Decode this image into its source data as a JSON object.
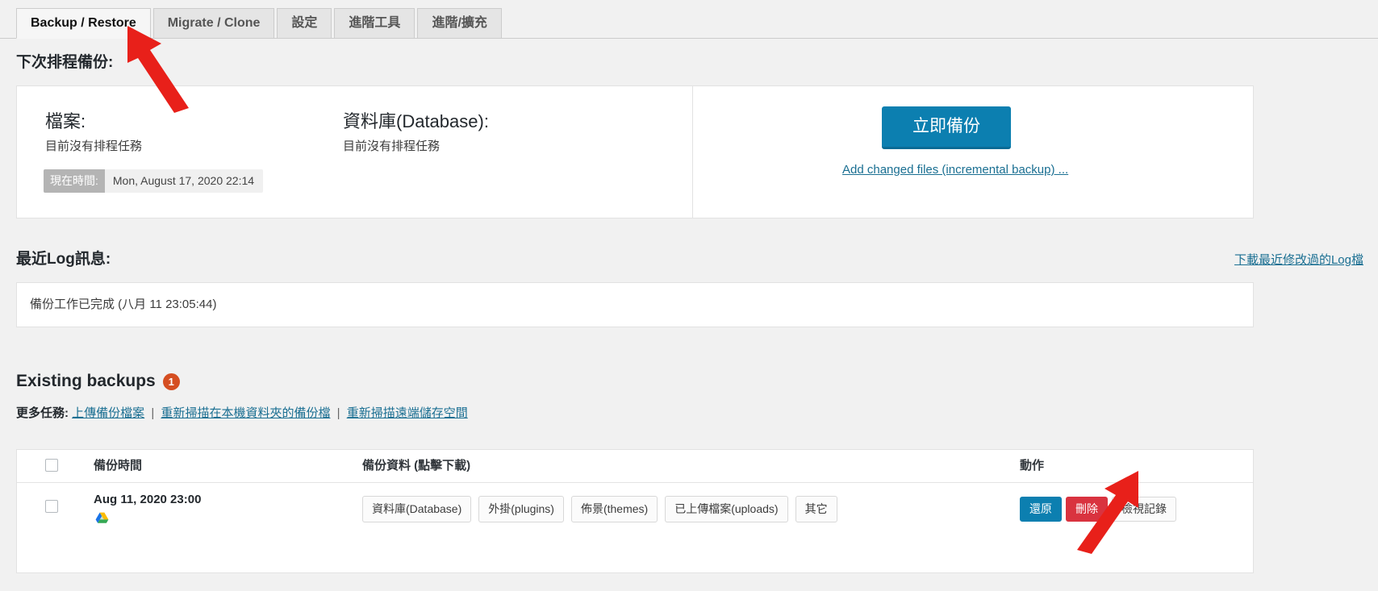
{
  "tabs": [
    {
      "label": "Backup / Restore",
      "active": true
    },
    {
      "label": "Migrate / Clone",
      "active": false
    },
    {
      "label": "設定",
      "active": false
    },
    {
      "label": "進階工具",
      "active": false
    },
    {
      "label": "進階/擴充",
      "active": false
    }
  ],
  "schedule": {
    "heading": "下次排程備份:",
    "files": {
      "title": "檔案:",
      "status": "目前沒有排程任務"
    },
    "database": {
      "title": "資料庫(Database):",
      "status": "目前沒有排程任務"
    },
    "current_time": {
      "label": "現在時間:",
      "value": "Mon, August 17, 2020 22:14"
    },
    "backup_now_button": "立即備份",
    "incremental_link": "Add changed files (incremental backup) ..."
  },
  "log": {
    "heading": "最近Log訊息:",
    "download_link": "下載最近修改過的Log檔",
    "message": "備份工作已完成 (八月 11 23:05:44)"
  },
  "existing_backups": {
    "title": "Existing backups",
    "count": "1",
    "more_tasks_label": "更多任務:",
    "more_tasks_links": [
      "上傳備份檔案",
      "重新掃描在本機資料夾的備份檔",
      "重新掃描遠端儲存空間"
    ],
    "separator": "|",
    "columns": {
      "time": "備份時間",
      "data": "備份資料 (點擊下載)",
      "actions": "動作"
    },
    "rows": [
      {
        "date": "Aug 11, 2020 23:00",
        "remote_storage_icon": "google-drive-icon",
        "entities": [
          "資料庫(Database)",
          "外掛(plugins)",
          "佈景(themes)",
          "已上傳檔案(uploads)",
          "其它"
        ],
        "actions": [
          {
            "label": "還原",
            "kind": "restore"
          },
          {
            "label": "刪除",
            "kind": "delete"
          },
          {
            "label": "檢視記錄",
            "kind": "log"
          }
        ]
      }
    ]
  },
  "colors": {
    "accent_blue": "#0c7fb0",
    "danger_red": "#d9333f",
    "badge_orange": "#d54e21",
    "link_blue": "#1a6f92",
    "arrow_red": "#e8201a",
    "page_bg": "#f1f1f1"
  },
  "annotations": [
    {
      "name": "arrow-pointing-to-backup-restore-tab"
    },
    {
      "name": "arrow-pointing-to-restore-button"
    }
  ]
}
